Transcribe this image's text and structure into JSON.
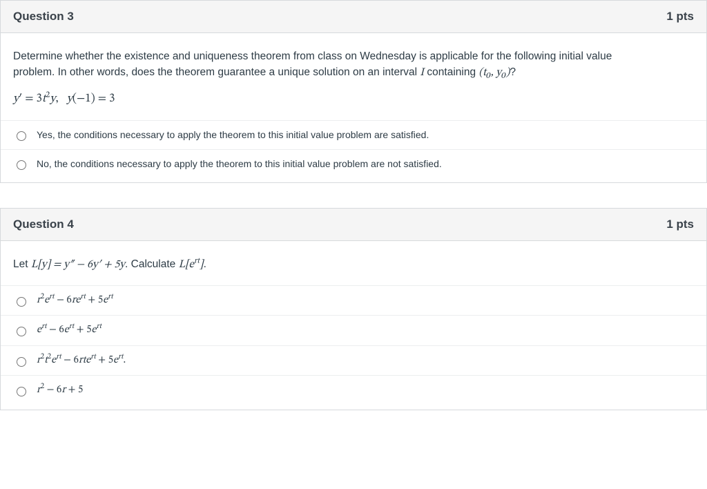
{
  "q3": {
    "title": "Question 3",
    "pts": "1 pts",
    "prompt_line1": "Determine whether the existence and uniqueness theorem from class on Wednesday is applicable for the following initial value",
    "prompt_line2_prefix": "problem. In other words, does the theorem guarantee a unique solution on an interval ",
    "prompt_line2_I": "I",
    "prompt_line2_mid": " containing ",
    "prompt_line2_tuple": "(t₀, y₀)",
    "prompt_line2_suffix": "?",
    "equation_html": "y′ = 3t²y,   y(−1) = 3",
    "options": [
      "Yes, the conditions necessary to apply the theorem to this initial value problem are satisfied.",
      "No, the conditions necessary to apply the theorem to this initial value problem are not satisfied."
    ]
  },
  "q4": {
    "title": "Question 4",
    "pts": "1 pts",
    "prompt_prefix": "Let ",
    "prompt_math1": "L[y] = y″ − 6y′ + 5y",
    "prompt_mid": ". Calculate ",
    "prompt_math2": "L[eʳᵗ]",
    "prompt_suffix": ".",
    "options": [
      "r²eʳᵗ − 6reʳᵗ + 5eʳᵗ",
      "eʳᵗ − 6eʳᵗ + 5eʳᵗ",
      "r²t²eʳᵗ − 6rteʳᵗ + 5eʳᵗ.",
      "r² − 6r + 5"
    ]
  }
}
